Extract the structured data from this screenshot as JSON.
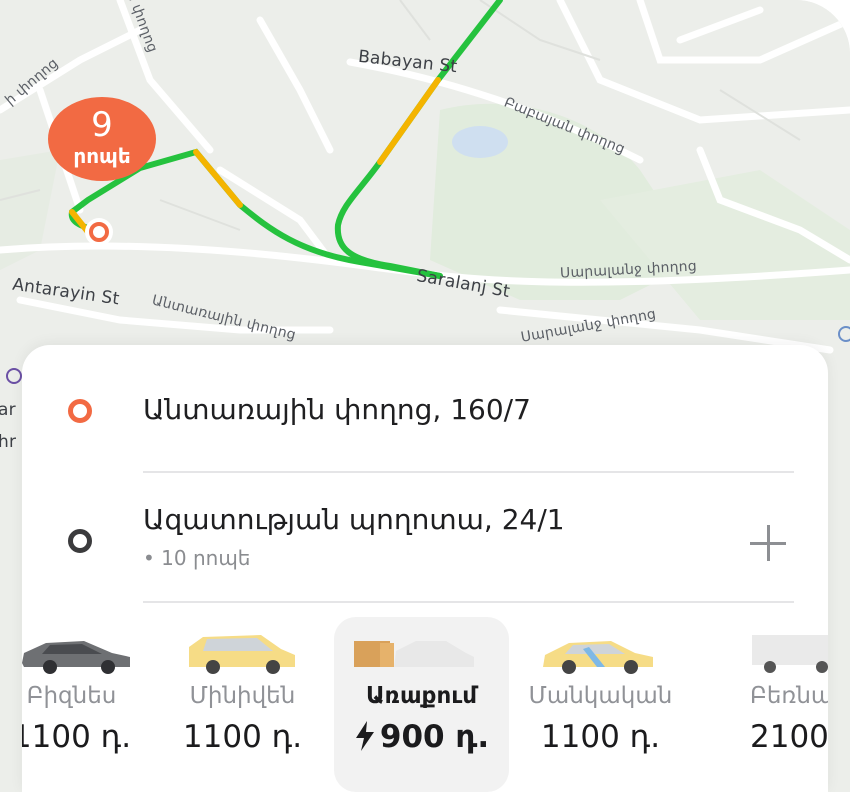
{
  "map": {
    "street_labels": [
      "Babayan St",
      "Բաբայան փողոց",
      "Antarayin St",
      "Saralanj St",
      "Սարալանջ փողոց",
      "Անտառային փողոց",
      "Սարալանջ փողոց",
      "ի փողոց",
      "ի փողոց",
      "ar",
      "hr"
    ],
    "route_colors": {
      "fast": "#25c23e",
      "slow": "#f4b400"
    },
    "eta_badge": {
      "number": "9",
      "unit": "րոպե",
      "color": "#f26a43"
    }
  },
  "route": {
    "from": {
      "address": "Անտառային փողոց, 160/7",
      "pin_color": "#f26a43"
    },
    "to": {
      "address": "Ազատության պողոտա, 24/1",
      "eta": "• 10 րոպե",
      "pin_color": "#3b3b3d"
    },
    "add_stop_icon": "plus-icon"
  },
  "tariffs": [
    {
      "name": "Բիզնես",
      "price": "1100 դ.",
      "car": "dark-sedan-icon",
      "selected": false
    },
    {
      "name": "Մինիվեն",
      "price": "1100 դ.",
      "car": "yellow-minivan-icon",
      "selected": false
    },
    {
      "name": "Առաքում",
      "price": "900 դ.",
      "car": "delivery-box-car-icon",
      "selected": true,
      "price_icon": "lightning-icon"
    },
    {
      "name": "Մանկական",
      "price": "1100 դ.",
      "car": "child-car-icon",
      "selected": false
    },
    {
      "name": "Բեռնա",
      "price": "2100",
      "car": "white-van-icon",
      "selected": false
    }
  ]
}
